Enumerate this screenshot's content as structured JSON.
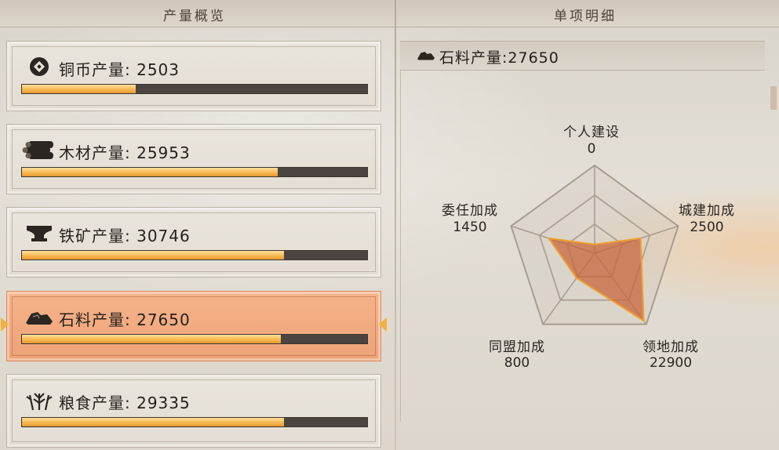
{
  "headers": {
    "overview": "产量概览",
    "detail": "单项明细"
  },
  "resources": [
    {
      "key": "copper",
      "label": "铜币产量: 2503",
      "icon": "coin-icon",
      "progress": 0.33
    },
    {
      "key": "wood",
      "label": "木材产量: 25953",
      "icon": "log-icon",
      "progress": 0.74
    },
    {
      "key": "iron",
      "label": "铁矿产量: 30746",
      "icon": "anvil-icon",
      "progress": 0.76
    },
    {
      "key": "stone",
      "label": "石料产量: 27650",
      "icon": "stone-icon",
      "progress": 0.75,
      "selected": true
    },
    {
      "key": "grain",
      "label": "粮食产量: 29335",
      "icon": "wheat-icon",
      "progress": 0.76
    }
  ],
  "detail": {
    "title": "石料产量:27650",
    "icon": "stone-icon",
    "radar": {
      "axes": [
        {
          "label": "个人建设",
          "value": "0"
        },
        {
          "label": "城建加成",
          "value": "2500"
        },
        {
          "label": "领地加成",
          "value": "22900"
        },
        {
          "label": "同盟加成",
          "value": "800"
        },
        {
          "label": "委任加成",
          "value": "1450"
        }
      ],
      "fill_levels": [
        0.1,
        0.55,
        0.95,
        0.35,
        0.55
      ]
    }
  },
  "colors": {
    "accent": "#f2b23d",
    "selected_card": "#f0a67b",
    "radar_fill": "#c8663c",
    "radar_stroke": "#f0a030"
  }
}
